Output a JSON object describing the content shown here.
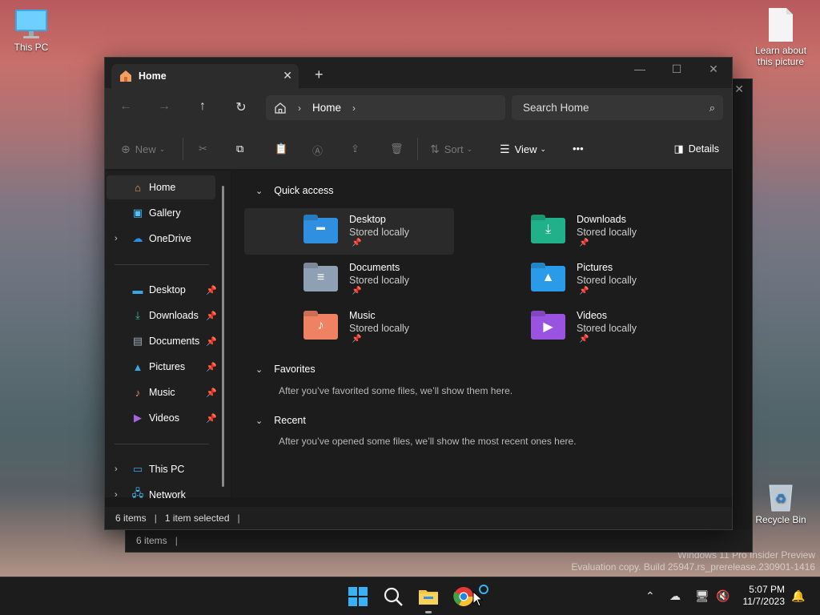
{
  "desktop": {
    "this_pc": "This PC",
    "learn": "Learn about this picture",
    "recycle": "Recycle Bin",
    "watermark_line1": "Windows 11 Pro Insider Preview",
    "watermark_line2": "Evaluation copy. Build 25947.rs_prerelease.230901-1416"
  },
  "back_window": {
    "status": "6 items"
  },
  "window": {
    "tab_title": "Home",
    "new_tab": "+",
    "breadcrumb": {
      "root_icon": "home-icon",
      "current": "Home"
    },
    "search_placeholder": "Search Home",
    "toolbar": {
      "new_label": "New",
      "sort_label": "Sort",
      "view_label": "View",
      "more_label": "•••",
      "details_label": "Details"
    },
    "sidebar": {
      "home": "Home",
      "gallery": "Gallery",
      "onedrive": "OneDrive",
      "desktop": "Desktop",
      "downloads": "Downloads",
      "documents": "Documents",
      "pictures": "Pictures",
      "music": "Music",
      "videos": "Videos",
      "this_pc": "This PC",
      "network": "Network"
    },
    "quick_access": {
      "title": "Quick access",
      "items": [
        {
          "name": "Desktop",
          "sub": "Stored locally"
        },
        {
          "name": "Downloads",
          "sub": "Stored locally"
        },
        {
          "name": "Documents",
          "sub": "Stored locally"
        },
        {
          "name": "Pictures",
          "sub": "Stored locally"
        },
        {
          "name": "Music",
          "sub": "Stored locally"
        },
        {
          "name": "Videos",
          "sub": "Stored locally"
        }
      ]
    },
    "favorites": {
      "title": "Favorites",
      "empty": "After you’ve favorited some files, we’ll show them here."
    },
    "recent": {
      "title": "Recent",
      "empty": "After you’ve opened some files, we’ll show the most recent ones here."
    },
    "status": {
      "count": "6 items",
      "selected": "1 item selected"
    }
  },
  "taskbar": {
    "time": "5:07 PM",
    "date": "11/7/2023"
  },
  "colors": {
    "accent": "#4cc2ff",
    "window_bg": "#191919",
    "taskbar_bg": "#1c1c1c"
  }
}
